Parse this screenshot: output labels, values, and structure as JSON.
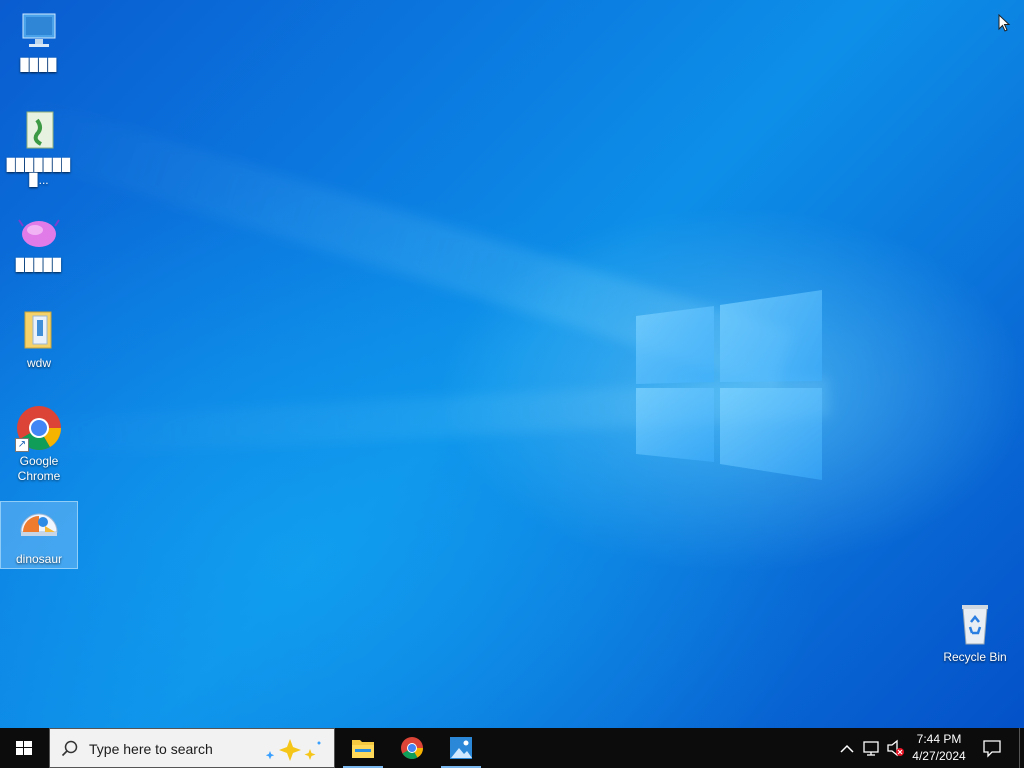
{
  "desktop": {
    "icons": [
      {
        "label": "▉▉▉▉"
      },
      {
        "label": "▉▉▉▉▉▉▉▉..."
      },
      {
        "label": "▉▉▉▉▉"
      },
      {
        "label": "wdw"
      },
      {
        "label": "Google Chrome"
      },
      {
        "label": "dinosaur"
      },
      {
        "label": "Recycle Bin"
      }
    ]
  },
  "taskbar": {
    "search_placeholder": "Type here to search",
    "apps": [
      "file-explorer",
      "google-chrome",
      "photos"
    ],
    "clock": {
      "time": "7:44 PM",
      "date": "4/27/2024"
    }
  },
  "colors": {
    "taskbar": "#0c0c0c",
    "accent": "#0078d7"
  }
}
